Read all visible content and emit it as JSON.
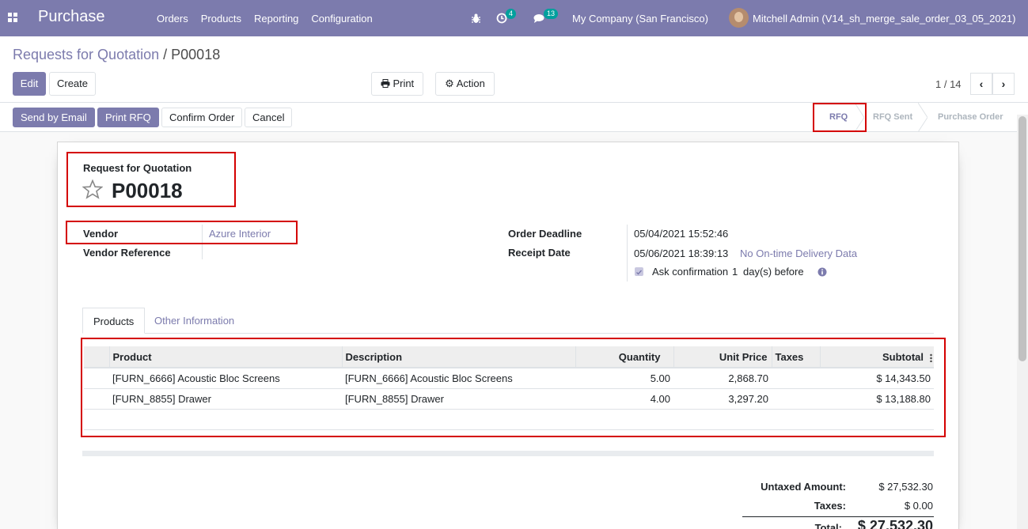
{
  "navbar": {
    "app_name": "Purchase",
    "menu": [
      "Orders",
      "Products",
      "Reporting",
      "Configuration"
    ],
    "activity_count": "4",
    "message_count": "13",
    "company": "My Company (San Francisco)",
    "user": "Mitchell Admin (V14_sh_merge_sale_order_03_05_2021)"
  },
  "control": {
    "breadcrumb_parent": "Requests for Quotation",
    "breadcrumb_sep": "/",
    "breadcrumb_current": "P00018",
    "edit_label": "Edit",
    "create_label": "Create",
    "print_label": "Print",
    "action_label": "Action",
    "pager": "1 / 14"
  },
  "statusbar": {
    "buttons": [
      "Send by Email",
      "Print RFQ",
      "Confirm Order",
      "Cancel"
    ],
    "stages": [
      "RFQ",
      "RFQ Sent",
      "Purchase Order"
    ],
    "active_stage": "RFQ"
  },
  "form": {
    "doc_type": "Request for Quotation",
    "name": "P00018",
    "vendor_label": "Vendor",
    "vendor_value": "Azure Interior",
    "vendor_ref_label": "Vendor Reference",
    "vendor_ref_value": "",
    "deadline_label": "Order Deadline",
    "deadline_value": "05/04/2021 15:52:46",
    "receipt_label": "Receipt Date",
    "receipt_value": "05/06/2021 18:39:13",
    "delivery_link": "No On-time Delivery Data",
    "ask_confirmation_prefix": "Ask confirmation",
    "ask_confirmation_days": "1",
    "ask_confirmation_suffix": "day(s) before",
    "ask_confirmation_checked": true
  },
  "tabs": [
    "Products",
    "Other Information"
  ],
  "lines": {
    "headers": [
      "Product",
      "Description",
      "Quantity",
      "Unit Price",
      "Taxes",
      "Subtotal"
    ],
    "rows": [
      [
        "[FURN_6666] Acoustic Bloc Screens",
        "[FURN_6666] Acoustic Bloc Screens",
        "5.00",
        "2,868.70",
        "",
        "$ 14,343.50"
      ],
      [
        "[FURN_8855] Drawer",
        "[FURN_8855] Drawer",
        "4.00",
        "3,297.20",
        "",
        "$ 13,188.80"
      ]
    ]
  },
  "totals": {
    "untaxed_label": "Untaxed Amount:",
    "untaxed_value": "$ 27,532.30",
    "taxes_label": "Taxes:",
    "taxes_value": "$ 0.00",
    "total_label": "Total:",
    "total_value": "$ 27,532.30"
  },
  "colors": {
    "brand": "#7c7bad",
    "highlight": "#d40000"
  }
}
